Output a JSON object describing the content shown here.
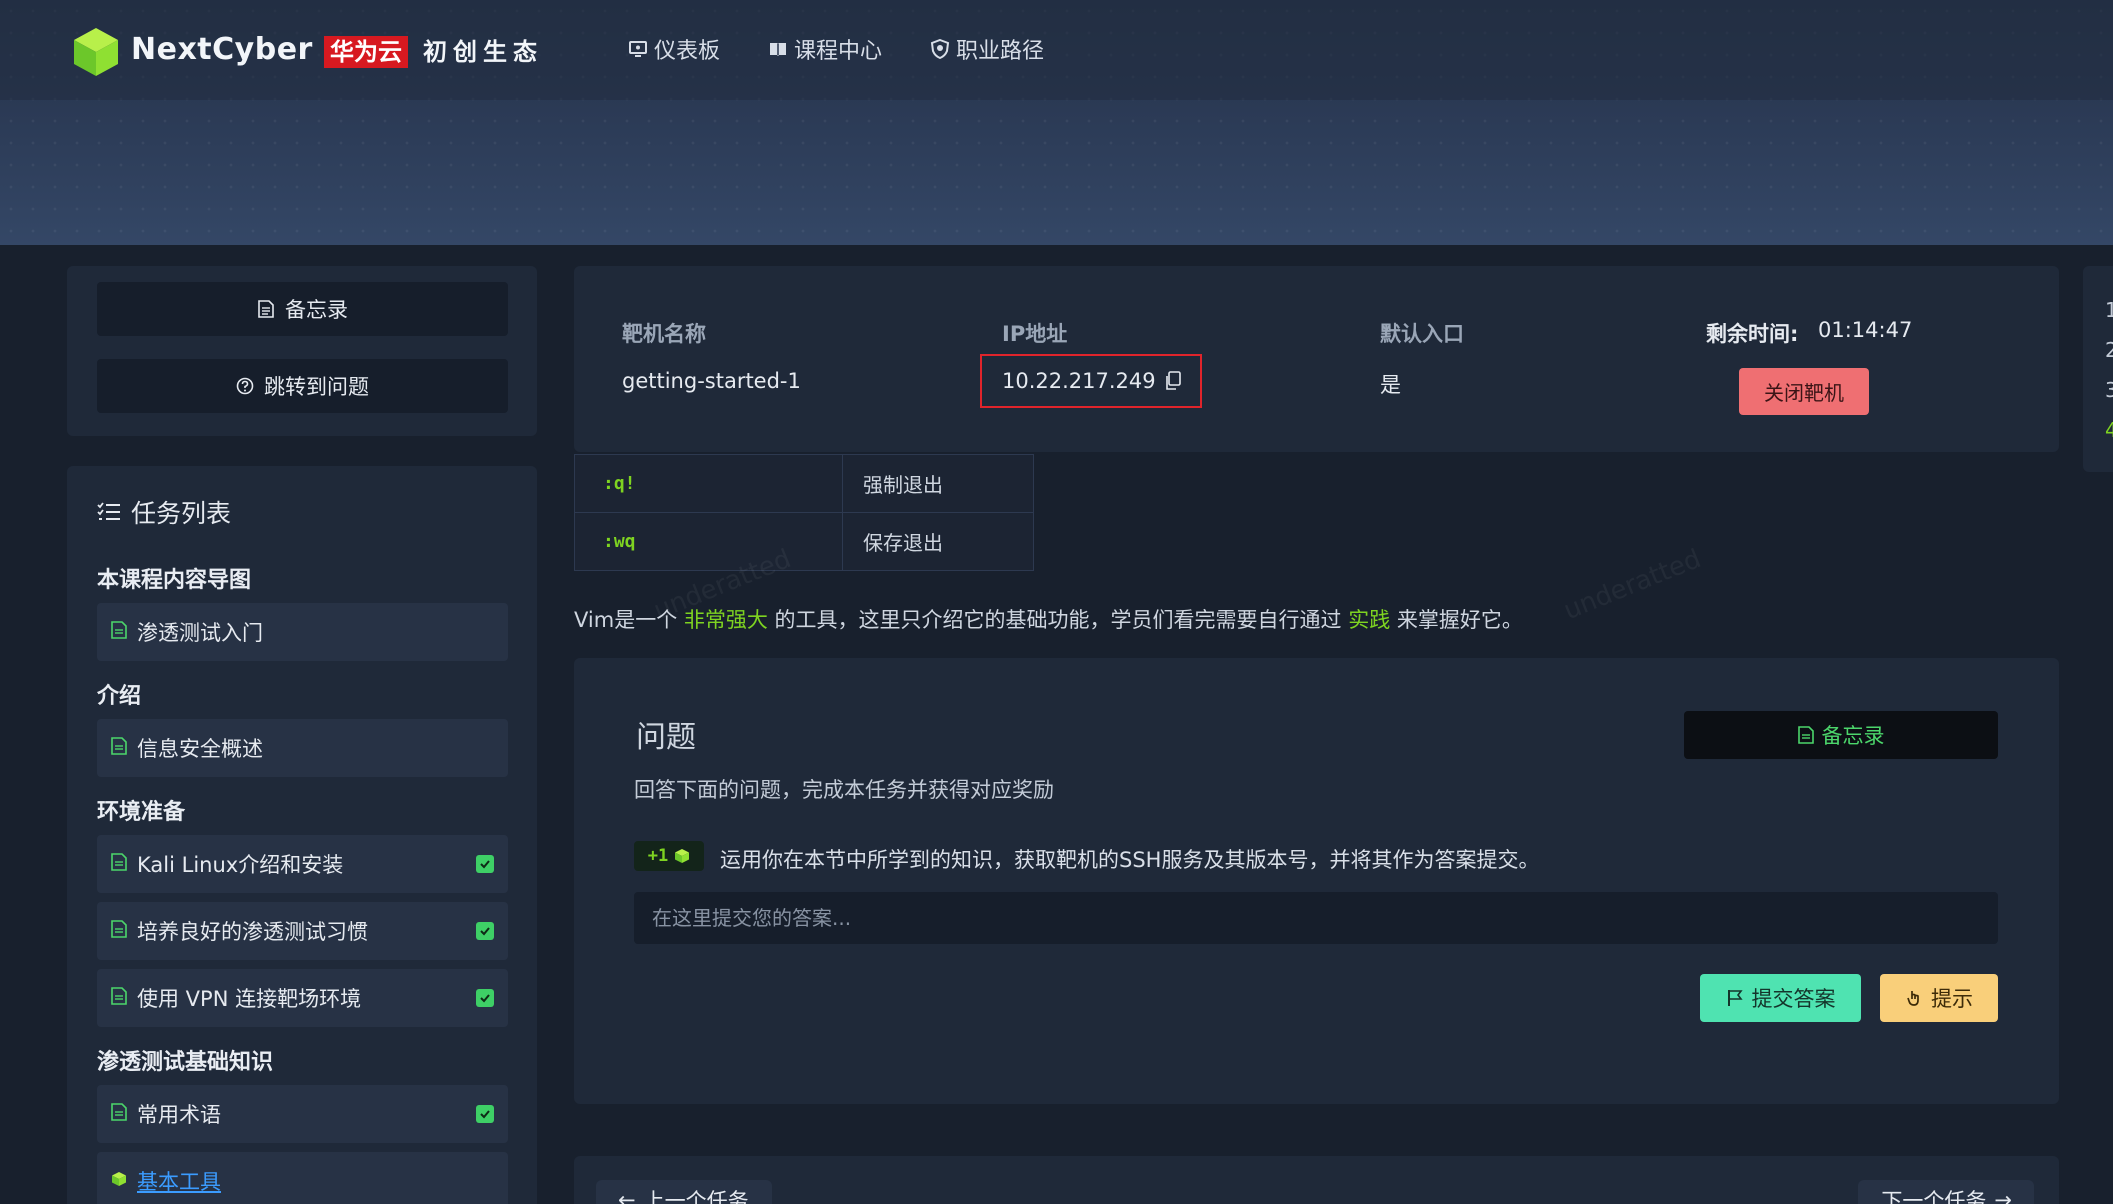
{
  "header": {
    "brand": "NextCyber",
    "partner_badge": "华为云",
    "partner_text": "初创生态",
    "nav": [
      {
        "label": "仪表板",
        "icon": "dashboard-icon"
      },
      {
        "label": "课程中心",
        "icon": "book-icon"
      },
      {
        "label": "职业路径",
        "icon": "shield-icon"
      }
    ]
  },
  "sidebar": {
    "notes_label": "备忘录",
    "jump_label": "跳转到问题",
    "tasks_title": "任务列表",
    "groups": [
      {
        "title": "本课程内容导图",
        "items": [
          {
            "label": "渗透测试入门",
            "done": false
          }
        ]
      },
      {
        "title": "介绍",
        "items": [
          {
            "label": "信息安全概述",
            "done": false
          }
        ]
      },
      {
        "title": "环境准备",
        "items": [
          {
            "label": "Kali Linux介绍和安装",
            "done": true
          },
          {
            "label": "培养良好的渗透测试习惯",
            "done": true
          },
          {
            "label": "使用 VPN 连接靶场环境",
            "done": true
          }
        ]
      },
      {
        "title": "渗透测试基础知识",
        "items": [
          {
            "label": "常用术语",
            "done": true
          },
          {
            "label": "基本工具",
            "done": false,
            "current": true
          }
        ]
      }
    ]
  },
  "machine": {
    "name_label": "靶机名称",
    "name_value": "getting-started-1",
    "ip_label": "IP地址",
    "ip_value": "10.22.217.249",
    "entry_label": "默认入口",
    "entry_value": "是",
    "remaining_label": "剩余时间:",
    "remaining_value": "01:14:47",
    "close_button": "关闭靶机"
  },
  "commands": [
    {
      "code": ":q!",
      "desc": "强制退出"
    },
    {
      "code": ":wq",
      "desc": "保存退出"
    }
  ],
  "intro": {
    "part1": "Vim是一个 ",
    "hl1": "非常强大",
    "part2": " 的工具，这里只介绍它的基础功能，学员们看完需要自行通过 ",
    "hl2": "实践",
    "part3": " 来掌握好它。"
  },
  "watermark": "underatted",
  "question": {
    "title": "问题",
    "notes_button": "备忘录",
    "subtitle": "回答下面的问题，完成本任务并获得对应奖励",
    "points": "+1",
    "text": "运用你在本节中所学到的知识，获取靶机的SSH服务及其版本号，并将其作为答案提交。",
    "placeholder": "在这里提交您的答案...",
    "submit_button": "提交答案",
    "hint_button": "提示"
  },
  "pager": {
    "prev": "上一个任务",
    "next": "下一个任务"
  },
  "toc": [
    "1",
    "2",
    "3",
    "4"
  ],
  "colors": {
    "accent_green": "#7ed321",
    "danger": "#ef6f72",
    "submit": "#4fe3b1",
    "hint": "#f9cf7a"
  }
}
